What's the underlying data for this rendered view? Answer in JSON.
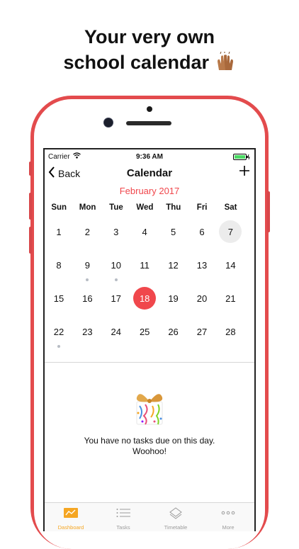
{
  "headline": {
    "line1": "Your very own",
    "line2": "school calendar",
    "emoji_icon": "raising-hands-icon"
  },
  "status_bar": {
    "carrier": "Carrier",
    "time": "9:36 AM"
  },
  "nav": {
    "back_label": "Back",
    "title": "Calendar",
    "add_icon": "plus-icon"
  },
  "calendar": {
    "month": "February 2017",
    "weekdays": [
      "Sun",
      "Mon",
      "Tue",
      "Wed",
      "Thu",
      "Fri",
      "Sat"
    ],
    "weeks": [
      [
        "1",
        "2",
        "3",
        "4",
        "5",
        "6",
        "7"
      ],
      [
        "8",
        "9",
        "10",
        "11",
        "12",
        "13",
        "14"
      ],
      [
        "15",
        "16",
        "17",
        "18",
        "19",
        "20",
        "21"
      ],
      [
        "22",
        "23",
        "24",
        "25",
        "26",
        "27",
        "28"
      ]
    ],
    "today": "7",
    "selected": "18",
    "days_with_tasks": [
      "9",
      "10",
      "22"
    ]
  },
  "empty_state": {
    "icon": "party-gift-icon",
    "line1": "You have no tasks due on this day.",
    "line2": "Woohoo!"
  },
  "tabbar": {
    "tabs": [
      {
        "label": "Dashboard",
        "icon": "dashboard-icon",
        "active": true
      },
      {
        "label": "Tasks",
        "icon": "list-icon",
        "active": false
      },
      {
        "label": "Timetable",
        "icon": "layers-icon",
        "active": false
      },
      {
        "label": "More",
        "icon": "more-dots-icon",
        "active": false
      }
    ]
  },
  "colors": {
    "accent": "#f0474c",
    "tab_active": "#f5a623",
    "phone_body": "#e34b4d"
  }
}
